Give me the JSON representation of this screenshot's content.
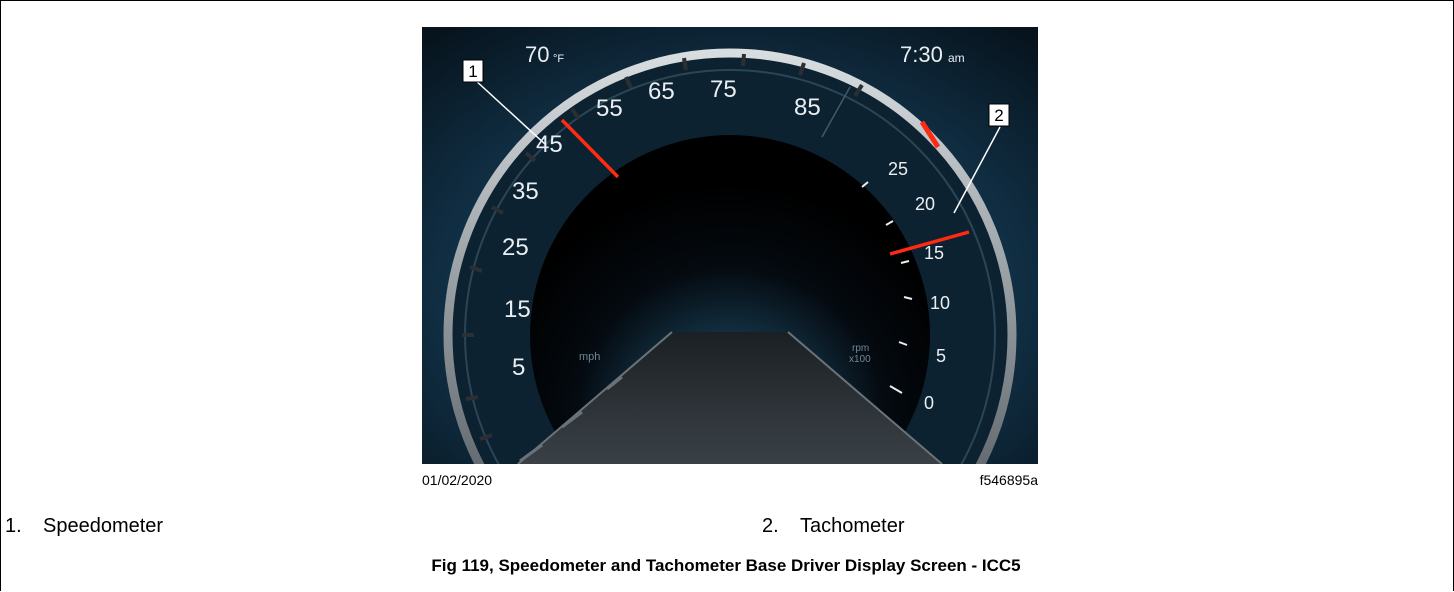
{
  "display": {
    "temperature": "70",
    "temperature_unit": "°F",
    "time": "7:30",
    "time_suffix": "am",
    "speed_labels": [
      "5",
      "15",
      "25",
      "35",
      "45",
      "55",
      "65",
      "75",
      "85"
    ],
    "speed_unit": "mph",
    "rpm_labels": [
      "0",
      "5",
      "10",
      "15",
      "20",
      "25"
    ],
    "rpm_unit_line1": "rpm",
    "rpm_unit_line2": "x100",
    "callout_1": "1",
    "callout_2": "2"
  },
  "figure": {
    "date": "01/02/2020",
    "id": "f546895a"
  },
  "legend": [
    {
      "number": "1.",
      "label": "Speedometer"
    },
    {
      "number": "2.",
      "label": "Tachometer"
    }
  ],
  "caption": "Fig 119, Speedometer and Tachometer Base Driver Display Screen - ICC5",
  "colors": {
    "needle": "#ff2a12",
    "background": "#0f2a3a",
    "glow": "#3fa0d0"
  }
}
